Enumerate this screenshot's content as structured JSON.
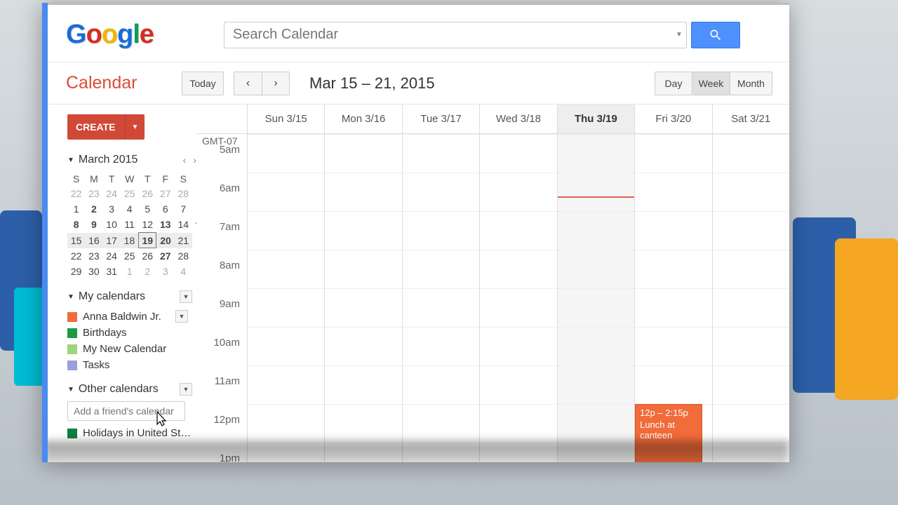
{
  "header": {
    "logo_text": "Google",
    "search_placeholder": "Search Calendar"
  },
  "toolbar": {
    "title": "Calendar",
    "today": "Today",
    "date_range": "Mar 15 – 21, 2015",
    "views": {
      "day": "Day",
      "week": "Week",
      "month": "Month"
    }
  },
  "sidebar": {
    "create": "CREATE",
    "mini_month": "March 2015",
    "dow": [
      "S",
      "M",
      "T",
      "W",
      "T",
      "F",
      "S"
    ],
    "weeks": [
      [
        "22",
        "23",
        "24",
        "25",
        "26",
        "27",
        "28"
      ],
      [
        "1",
        "2",
        "3",
        "4",
        "5",
        "6",
        "7"
      ],
      [
        "8",
        "9",
        "10",
        "11",
        "12",
        "13",
        "14"
      ],
      [
        "15",
        "16",
        "17",
        "18",
        "19",
        "20",
        "21"
      ],
      [
        "22",
        "23",
        "24",
        "25",
        "26",
        "27",
        "28"
      ],
      [
        "29",
        "30",
        "31",
        "1",
        "2",
        "3",
        "4"
      ]
    ],
    "my_calendars_label": "My calendars",
    "my_calendars": [
      {
        "name": "Anna Baldwin Jr.",
        "color": "#f26b3a",
        "dropdown": true
      },
      {
        "name": "Birthdays",
        "color": "#1a9c3f"
      },
      {
        "name": "My New Calendar",
        "color": "#9fd57a"
      },
      {
        "name": "Tasks",
        "color": "#9aa0dc"
      }
    ],
    "other_calendars_label": "Other calendars",
    "friend_placeholder": "Add a friend's calendar",
    "other_calendars": [
      {
        "name": "Holidays in United St…",
        "color": "#0b8043"
      }
    ]
  },
  "grid": {
    "gmt": "GMT-07",
    "days": [
      "Sun 3/15",
      "Mon 3/16",
      "Tue 3/17",
      "Wed 3/18",
      "Thu 3/19",
      "Fri 3/20",
      "Sat 3/21"
    ],
    "hours": [
      "5am",
      "6am",
      "7am",
      "8am",
      "9am",
      "10am",
      "11am",
      "12pm",
      "1pm"
    ],
    "today_index": 4,
    "event": {
      "time": "12p – 2:15p",
      "title": "Lunch at canteen"
    }
  }
}
